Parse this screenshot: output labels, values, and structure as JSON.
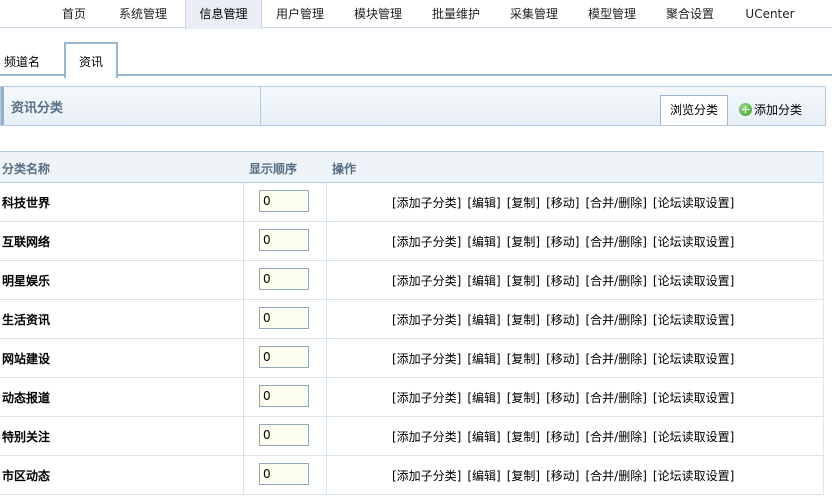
{
  "topnav": {
    "tabs": [
      {
        "label": "首页",
        "active": false
      },
      {
        "label": "系统管理",
        "active": false
      },
      {
        "label": "信息管理",
        "active": true
      },
      {
        "label": "用户管理",
        "active": false
      },
      {
        "label": "模块管理",
        "active": false
      },
      {
        "label": "批量维护",
        "active": false
      },
      {
        "label": "采集管理",
        "active": false
      },
      {
        "label": "模型管理",
        "active": false
      },
      {
        "label": "聚合设置",
        "active": false
      },
      {
        "label": "UCenter",
        "active": false
      }
    ]
  },
  "channel": {
    "label": "频道名",
    "tab": "资讯"
  },
  "section": {
    "title": "资讯分类",
    "browse_label": "浏览分类",
    "add_label": "添加分类",
    "add_icon": "plus-circle-icon"
  },
  "table": {
    "headers": {
      "name": "分类名称",
      "order": "显示顺序",
      "actions": "操作"
    },
    "action_labels": [
      "[添加子分类]",
      "[编辑]",
      "[复制]",
      "[移动]",
      "[合并/删除]",
      "[论坛读取设置]"
    ],
    "rows": [
      {
        "name": "科技世界",
        "order": "0"
      },
      {
        "name": "互联网络",
        "order": "0"
      },
      {
        "name": "明星娱乐",
        "order": "0"
      },
      {
        "name": "生活资讯",
        "order": "0"
      },
      {
        "name": "网站建设",
        "order": "0"
      },
      {
        "name": "动态报道",
        "order": "0"
      },
      {
        "name": "特别关注",
        "order": "0"
      },
      {
        "name": "市区动态",
        "order": "0"
      }
    ]
  },
  "colors": {
    "header_text": "#5a6f86",
    "border": "#b7cbdf",
    "tab_active_bg": "#e9eff5",
    "add_icon": "#3a9a2a"
  }
}
